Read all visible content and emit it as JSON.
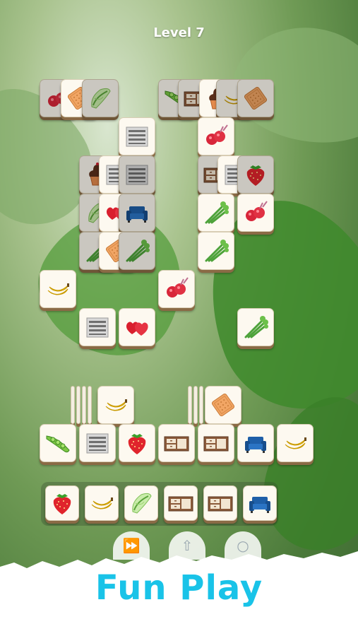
{
  "level_title": "Level 7",
  "tagline": "Fun Play",
  "tools": [
    "shuffle-icon",
    "undo-icon",
    "hint-icon"
  ],
  "board": [
    {
      "icon": "radish",
      "dim": true
    },
    {
      "icon": "biscuit",
      "dim": false
    },
    {
      "icon": "cabbage",
      "dim": true
    },
    {
      "icon": "peas",
      "dim": true
    },
    {
      "icon": "cabinet",
      "dim": true
    },
    {
      "icon": "cupcake",
      "dim": false
    },
    {
      "icon": "banana",
      "dim": true
    },
    {
      "icon": "biscuit",
      "dim": true
    },
    {
      "icon": "shelf",
      "dim": false
    },
    {
      "icon": "radish",
      "dim": false
    },
    {
      "icon": "cupcake",
      "dim": true
    },
    {
      "icon": "shelf",
      "dim": false
    },
    {
      "icon": "shelf",
      "dim": true
    },
    {
      "icon": "cabinet",
      "dim": true
    },
    {
      "icon": "shelf",
      "dim": false
    },
    {
      "icon": "strawberry",
      "dim": true
    },
    {
      "icon": "cabbage",
      "dim": true
    },
    {
      "icon": "hearts",
      "dim": false
    },
    {
      "icon": "sofa",
      "dim": true
    },
    {
      "icon": "celery",
      "dim": false
    },
    {
      "icon": "radish",
      "dim": false
    },
    {
      "icon": "celery",
      "dim": true
    },
    {
      "icon": "biscuit",
      "dim": false
    },
    {
      "icon": "celery",
      "dim": true
    },
    {
      "icon": "celery",
      "dim": false
    },
    {
      "icon": "banana",
      "dim": false
    },
    {
      "icon": "radish",
      "dim": false
    },
    {
      "icon": "shelf",
      "dim": false
    },
    {
      "icon": "hearts",
      "dim": false
    },
    {
      "icon": "celery",
      "dim": false
    },
    {
      "icon": "banana",
      "dim": false
    },
    {
      "icon": "biscuit",
      "dim": false
    },
    {
      "icon": "peas",
      "dim": false
    },
    {
      "icon": "shelf",
      "dim": false
    },
    {
      "icon": "strawberry",
      "dim": false
    },
    {
      "icon": "cabinet",
      "dim": false
    },
    {
      "icon": "cabinet",
      "dim": false
    },
    {
      "icon": "sofa",
      "dim": false
    },
    {
      "icon": "banana",
      "dim": false
    }
  ],
  "tray": [
    {
      "icon": "strawberry"
    },
    {
      "icon": "banana"
    },
    {
      "icon": "cabbage"
    },
    {
      "icon": "cabinet"
    },
    {
      "icon": "cabinet"
    },
    {
      "icon": "sofa"
    }
  ],
  "colors": {
    "tagline": "#19c3e8",
    "tile_face": "#fdf9f0",
    "tile_base": "#8a6a45"
  }
}
